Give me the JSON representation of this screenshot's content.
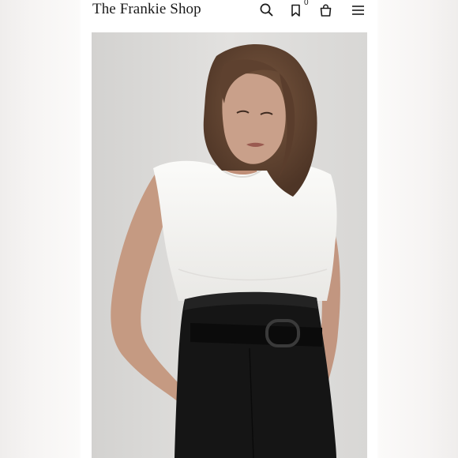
{
  "header": {
    "brand": "The Frankie Shop",
    "wishlist_count": "0",
    "icons": [
      "search-icon",
      "bookmark-icon",
      "bag-icon",
      "menu-icon"
    ]
  },
  "hero": {
    "image_description": "model in white sleeveless tee and black high-waisted belted trousers"
  },
  "colors": {
    "text": "#1a1a1a",
    "wall": "#dcdbd9",
    "shirt": "#f8f8f6",
    "trousers": "#151515",
    "skin": "#c59a82",
    "hair": "#6a4a35"
  }
}
